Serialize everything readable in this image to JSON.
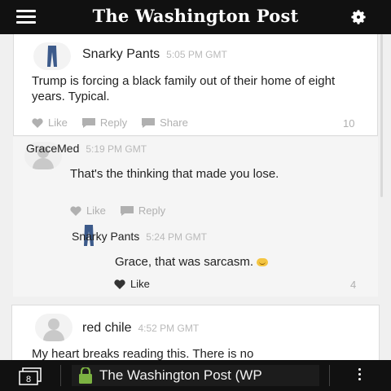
{
  "header": {
    "title": "The Washington Post"
  },
  "comments": [
    {
      "author": "Snarky Pants",
      "time": "5:05 PM GMT",
      "text": "Trump is forcing a black family out of their home of eight years. Typical.",
      "actions": [
        "Like",
        "Reply",
        "Share"
      ],
      "likes": "10"
    },
    {
      "author": "GraceMed",
      "time": "5:19 PM GMT",
      "text": "That's the thinking that made you lose.",
      "actions": [
        "Like",
        "Reply"
      ]
    },
    {
      "author": "Snarky Pants",
      "time": "5:24 PM GMT",
      "text": "Grace, that was sarcasm.",
      "actions": [
        "Like"
      ],
      "likes": "4"
    },
    {
      "author": "red chile",
      "time": "4:52 PM GMT",
      "text": "My heart breaks reading this. There is no"
    }
  ],
  "bottom_bar": {
    "tab_count": "8",
    "url_text": "The Washington Post (WP"
  },
  "colors": {
    "bar_bg": "#111111",
    "lock_green": "#7cb342",
    "muted": "#b0b0b0"
  }
}
